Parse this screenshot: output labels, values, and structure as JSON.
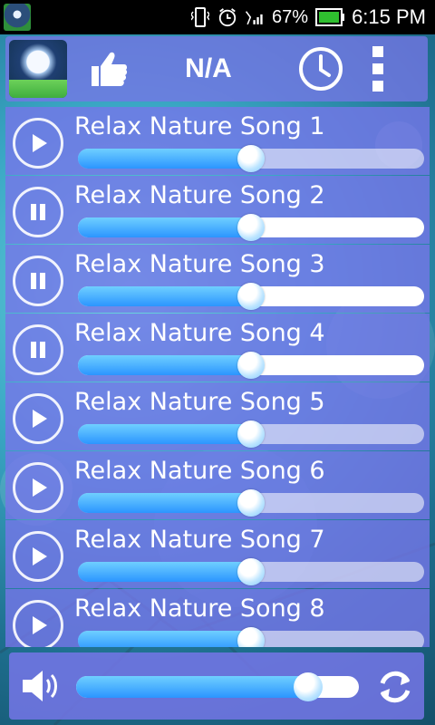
{
  "status_bar": {
    "battery_percent": "67%",
    "time": "6:15 PM",
    "icons": [
      "app-icon",
      "vibrate-icon",
      "alarm-icon",
      "signal-icon",
      "battery-icon"
    ]
  },
  "header": {
    "title": "N/A",
    "icons": [
      "app-thumbnail-icon",
      "thumbs-up-icon",
      "clock-icon",
      "overflow-menu-icon"
    ]
  },
  "songs": [
    {
      "title": "Relax Nature Song 1",
      "state": "stopped",
      "volume": 0.5
    },
    {
      "title": "Relax Nature Song 2",
      "state": "playing",
      "volume": 0.5
    },
    {
      "title": "Relax Nature Song 3",
      "state": "playing",
      "volume": 0.5
    },
    {
      "title": "Relax Nature Song 4",
      "state": "playing",
      "volume": 0.5
    },
    {
      "title": "Relax Nature Song 5",
      "state": "stopped",
      "volume": 0.5
    },
    {
      "title": "Relax Nature Song 6",
      "state": "stopped",
      "volume": 0.5
    },
    {
      "title": "Relax Nature Song 7",
      "state": "stopped",
      "volume": 0.5
    },
    {
      "title": "Relax Nature Song 8",
      "state": "stopped",
      "volume": 0.5
    }
  ],
  "bottom_bar": {
    "master_volume": 0.82,
    "icons": [
      "speaker-volume-icon",
      "refresh-icon"
    ]
  },
  "colors": {
    "panel": "#7676e8",
    "slider_fill": "#2b95ff",
    "status_bar": "#000000"
  }
}
